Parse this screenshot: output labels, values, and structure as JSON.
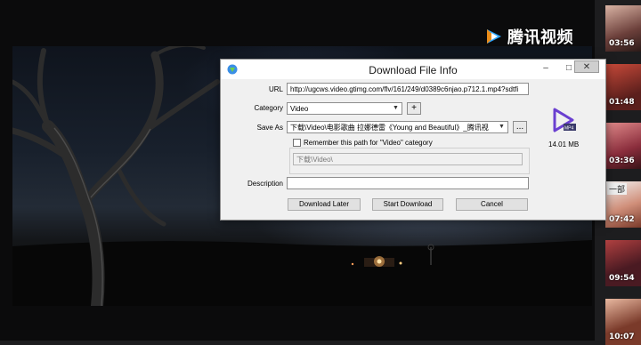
{
  "brand": {
    "name": "腾讯视频"
  },
  "thumbnails": [
    {
      "duration": "03:56",
      "caption": ""
    },
    {
      "duration": "01:48",
      "caption": ""
    },
    {
      "duration": "03:36",
      "caption": ""
    },
    {
      "duration": "07:42",
      "caption": "一部"
    },
    {
      "duration": "09:54",
      "caption": ""
    },
    {
      "duration": "10:07",
      "caption": ""
    }
  ],
  "dialog": {
    "title": "Download File Info",
    "url_label": "URL",
    "url_value": "http://ugcws.video.gtimg.com/flv/161/249/d0389c6njao.p712.1.mp4?sdtfi",
    "category_label": "Category",
    "category_value": "Video",
    "add_category_symbol": "+",
    "save_as_label": "Save As",
    "save_as_value": "下载\\Video\\电影歌曲 拉娜德雷《Young and Beautiful》_腾讯视",
    "browse_label": "...",
    "remember_label": "Remember this path for \"Video\" category",
    "remember_path": "下载\\Video\\",
    "description_label": "Description",
    "description_value": "",
    "file_size": "14.01  MB",
    "file_type_icon": "video-file-icon",
    "download_later_label": "Download Later",
    "start_download_label": "Start Download",
    "cancel_label": "Cancel",
    "minimize_symbol": "–",
    "maximize_symbol": "□",
    "close_symbol": "✕"
  }
}
